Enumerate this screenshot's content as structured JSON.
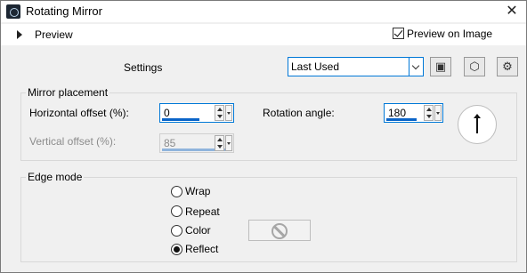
{
  "window": {
    "title": "Rotating Mirror",
    "close_symbol": "✕"
  },
  "preview": {
    "label": "Preview",
    "preview_on_image_label": "Preview on Image",
    "preview_on_image_checked": true
  },
  "settings": {
    "label": "Settings",
    "preset_value": "Last Used",
    "tool_icons": [
      "save-icon",
      "randomize-icon",
      "manage-presets-icon"
    ]
  },
  "mirror_placement": {
    "title": "Mirror placement",
    "horizontal_offset_label": "Horizontal offset (%):",
    "horizontal_offset_value": "0",
    "vertical_offset_label": "Vertical offset (%):",
    "vertical_offset_value": "85",
    "rotation_angle_label": "Rotation angle:",
    "rotation_angle_value": "180"
  },
  "edge_mode": {
    "title": "Edge mode",
    "options": [
      {
        "label": "Wrap",
        "selected": false
      },
      {
        "label": "Repeat",
        "selected": false
      },
      {
        "label": "Color",
        "selected": false
      },
      {
        "label": "Reflect",
        "selected": true
      }
    ]
  },
  "colors": {
    "accent": "#0078d7",
    "disabled_text": "#8c8c8c"
  }
}
